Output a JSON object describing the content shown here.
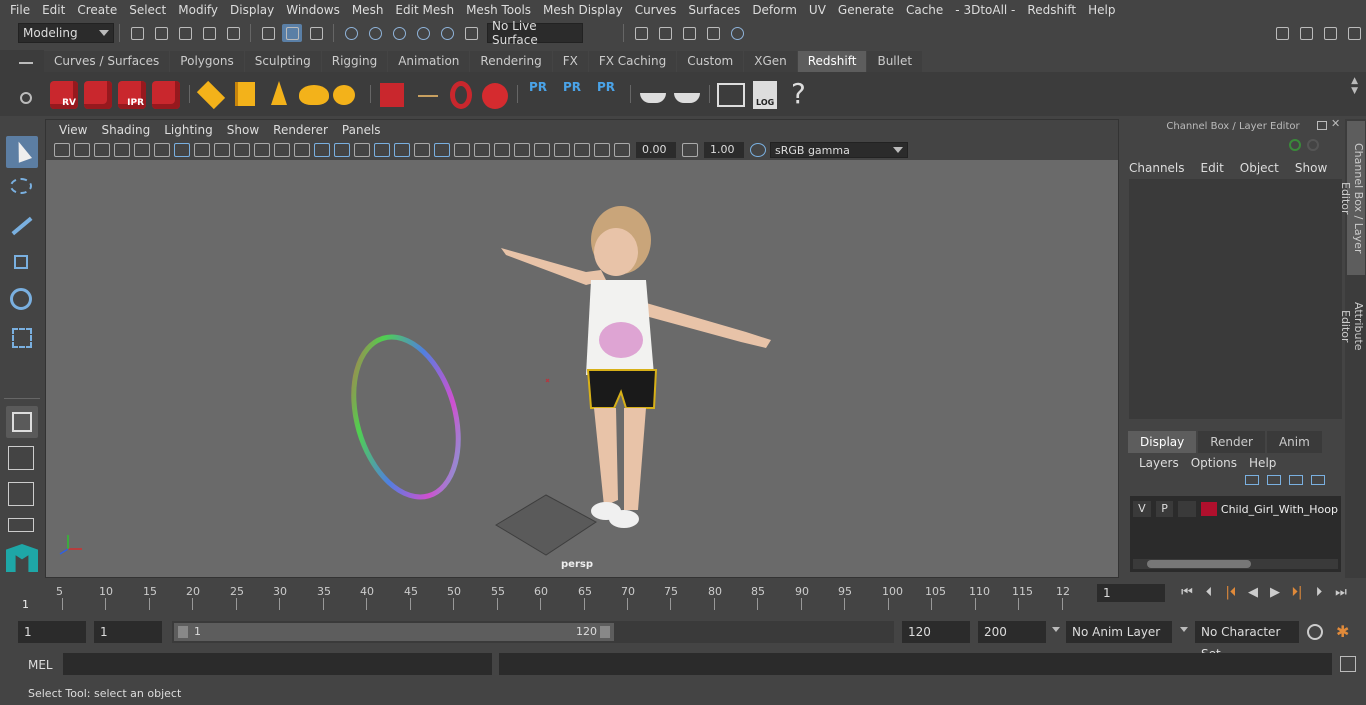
{
  "menubar": [
    "File",
    "Edit",
    "Create",
    "Select",
    "Modify",
    "Display",
    "Windows",
    "Mesh",
    "Edit Mesh",
    "Mesh Tools",
    "Mesh Display",
    "Curves",
    "Surfaces",
    "Deform",
    "UV",
    "Generate",
    "Cache",
    "- 3DtoAll -",
    "Redshift",
    "Help"
  ],
  "status": {
    "workspace": "Modeling",
    "live_surface": "No Live Surface"
  },
  "shelf_tabs": [
    "Curves / Surfaces",
    "Polygons",
    "Sculpting",
    "Rigging",
    "Animation",
    "Rendering",
    "FX",
    "FX Caching",
    "Custom",
    "XGen",
    "Redshift",
    "Bullet"
  ],
  "active_shelf": "Redshift",
  "shelf_icons": [
    {
      "name": "rv-icon",
      "label": "RV"
    },
    {
      "name": "render-icon",
      "label": ""
    },
    {
      "name": "ipr-icon",
      "label": "IPR"
    },
    {
      "name": "settings-cube-icon",
      "label": ""
    }
  ],
  "pr_labels": [
    "PR",
    "PR",
    "PR"
  ],
  "log_label": "LOG",
  "viewport": {
    "menu": [
      "View",
      "Shading",
      "Lighting",
      "Show",
      "Renderer",
      "Panels"
    ],
    "exposure": "0.00",
    "gamma": "1.00",
    "color_space": "sRGB gamma",
    "camera": "persp"
  },
  "channel_box": {
    "title": "Channel Box / Layer Editor",
    "menu": [
      "Channels",
      "Edit",
      "Object",
      "Show"
    ]
  },
  "layer_editor": {
    "tabs": [
      "Display",
      "Render",
      "Anim"
    ],
    "active_tab": "Display",
    "menu": [
      "Layers",
      "Options",
      "Help"
    ],
    "layers": [
      {
        "v": "V",
        "p": "P",
        "color": "#b0102d",
        "name": "Child_Girl_With_Hoop"
      }
    ]
  },
  "side_tabs": [
    "Channel Box / Layer Editor",
    "Attribute Editor"
  ],
  "timeline": {
    "ticks": [
      "5",
      "10",
      "15",
      "20",
      "25",
      "30",
      "35",
      "40",
      "45",
      "50",
      "55",
      "60",
      "65",
      "70",
      "75",
      "80",
      "85",
      "90",
      "95",
      "100",
      "105",
      "110",
      "115",
      "12"
    ],
    "current_frame": "1",
    "frame_field": "1"
  },
  "range": {
    "start": "1",
    "playback_start": "1",
    "slider_start": "1",
    "slider_end": "120",
    "playback_end": "120",
    "end": "200",
    "anim_layer": "No Anim Layer",
    "character_set": "No Character Set"
  },
  "cmd": {
    "lang": "MEL"
  },
  "help_line": "Select Tool: select an object"
}
